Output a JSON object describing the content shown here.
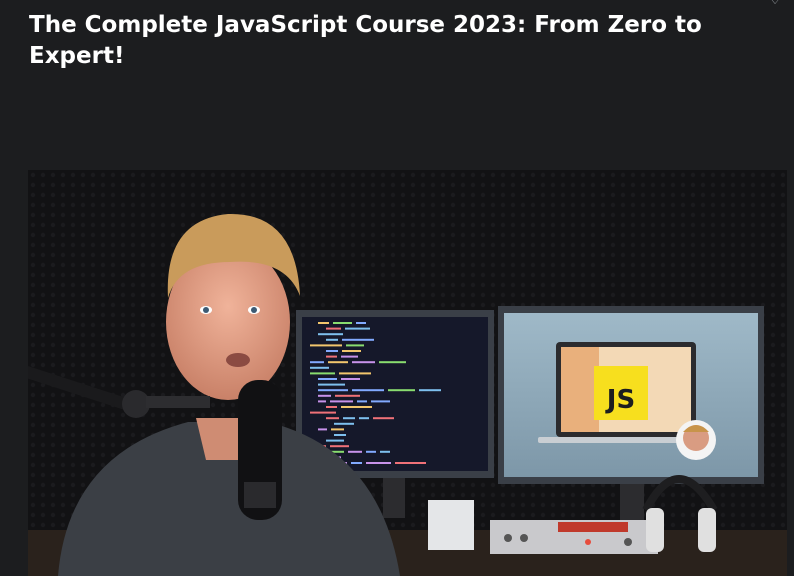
{
  "course": {
    "title": "The Complete JavaScript Course 2023: From Zero to Expert!"
  },
  "header": {
    "wishlist_icon": "heart-outline-icon"
  },
  "preview": {
    "badge_text": "JS",
    "colors": {
      "page_bg": "#1c1d1f",
      "badge": "#f7df1e",
      "title": "#ffffff"
    }
  }
}
